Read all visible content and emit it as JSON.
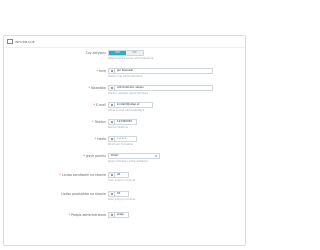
{
  "panel": {
    "title": "Informacje"
  },
  "fields": {
    "status": {
      "label": "Czy aktywny",
      "options": [
        "TAK",
        "NIE"
      ],
      "selected": "TAK",
      "help": "Włącz/wyłącz konto administratora"
    },
    "first_name": {
      "label": "Imię",
      "value": "Jan Kowalski",
      "help": "Wpisz imię administratora"
    },
    "last_name": {
      "label": "Nazwisko",
      "value": "Administrator sklepu",
      "help": "Wpisz nazwisko administratora"
    },
    "email": {
      "label": "E-mail",
      "value": "kontakt@sklep.pl",
      "help": "Adres e-mail administratora"
    },
    "phone": {
      "label": "Telefon",
      "value": "123456789",
      "help": "Numer telefonu"
    },
    "password": {
      "label": "Hasło",
      "value": "••••••",
      "help": "Minimum 8 znaków"
    },
    "language": {
      "label": "Język panelu",
      "value": "Polski",
      "help": "Język interfejsu administratora"
    },
    "orders": {
      "label": "Liczba zamówień na stronie",
      "value": "20",
      "help": "Ilość pozycji na liście"
    },
    "products": {
      "label": "Liczba produktów na stronie",
      "value": "50",
      "help": "Ilość pozycji na liście"
    },
    "signature": {
      "label": "Podpis administratora",
      "value": "sklep",
      "help": ""
    }
  }
}
